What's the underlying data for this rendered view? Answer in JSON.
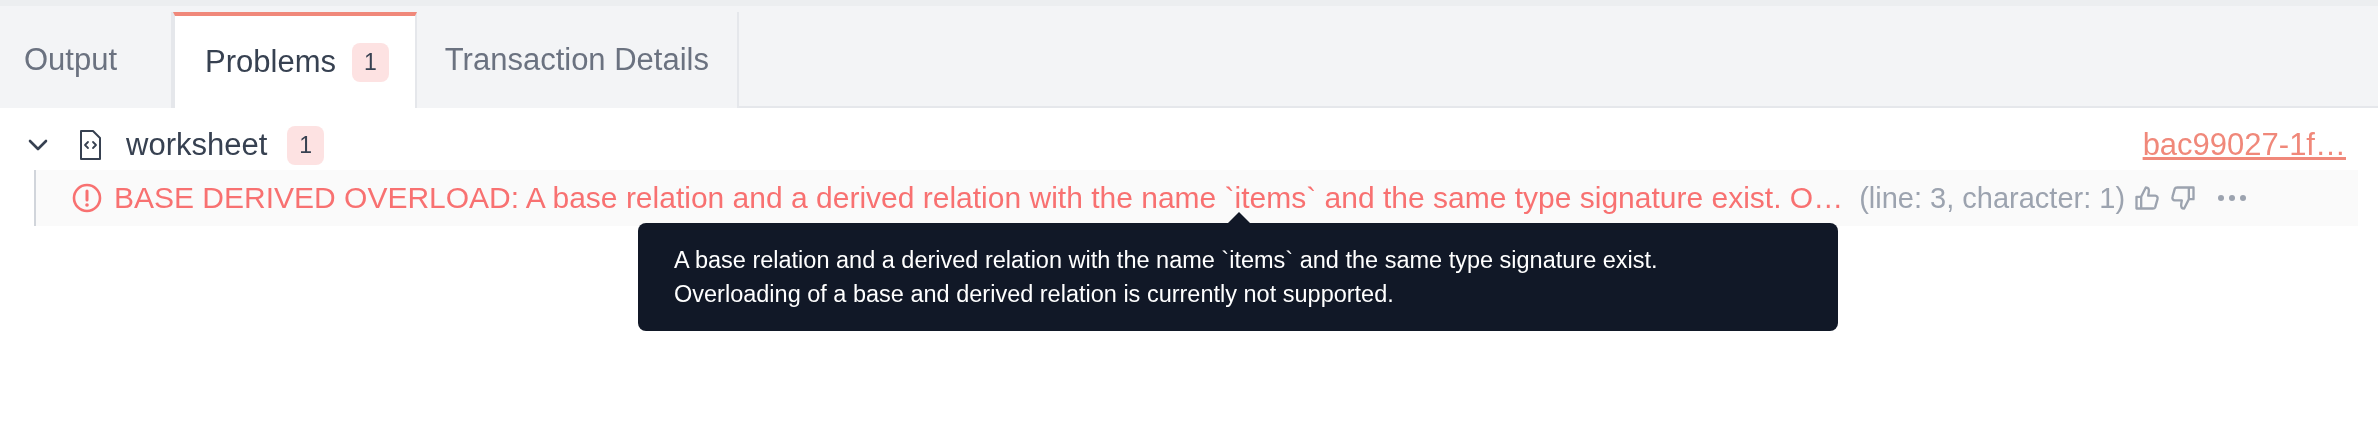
{
  "tabs": [
    {
      "label": "Output",
      "selected": false
    },
    {
      "label": "Problems",
      "selected": true,
      "badge": "1"
    },
    {
      "label": "Transaction Details",
      "selected": false
    }
  ],
  "files": [
    {
      "name": "worksheet",
      "badge": "1",
      "expanded": true,
      "link": "bac99027-1f…",
      "problems": [
        {
          "code": "BASE DERIVED OVERLOAD:",
          "message": "A base relation and a derived relation with the name `items` and the same type signature exist. O…",
          "location": "(line: 3, character: 1)"
        }
      ]
    }
  ],
  "tooltip": {
    "lines": [
      "A base relation and a derived relation with the name `items` and the same type signature exist.",
      "Overloading of a base and derived relation is currently not supported."
    ]
  }
}
